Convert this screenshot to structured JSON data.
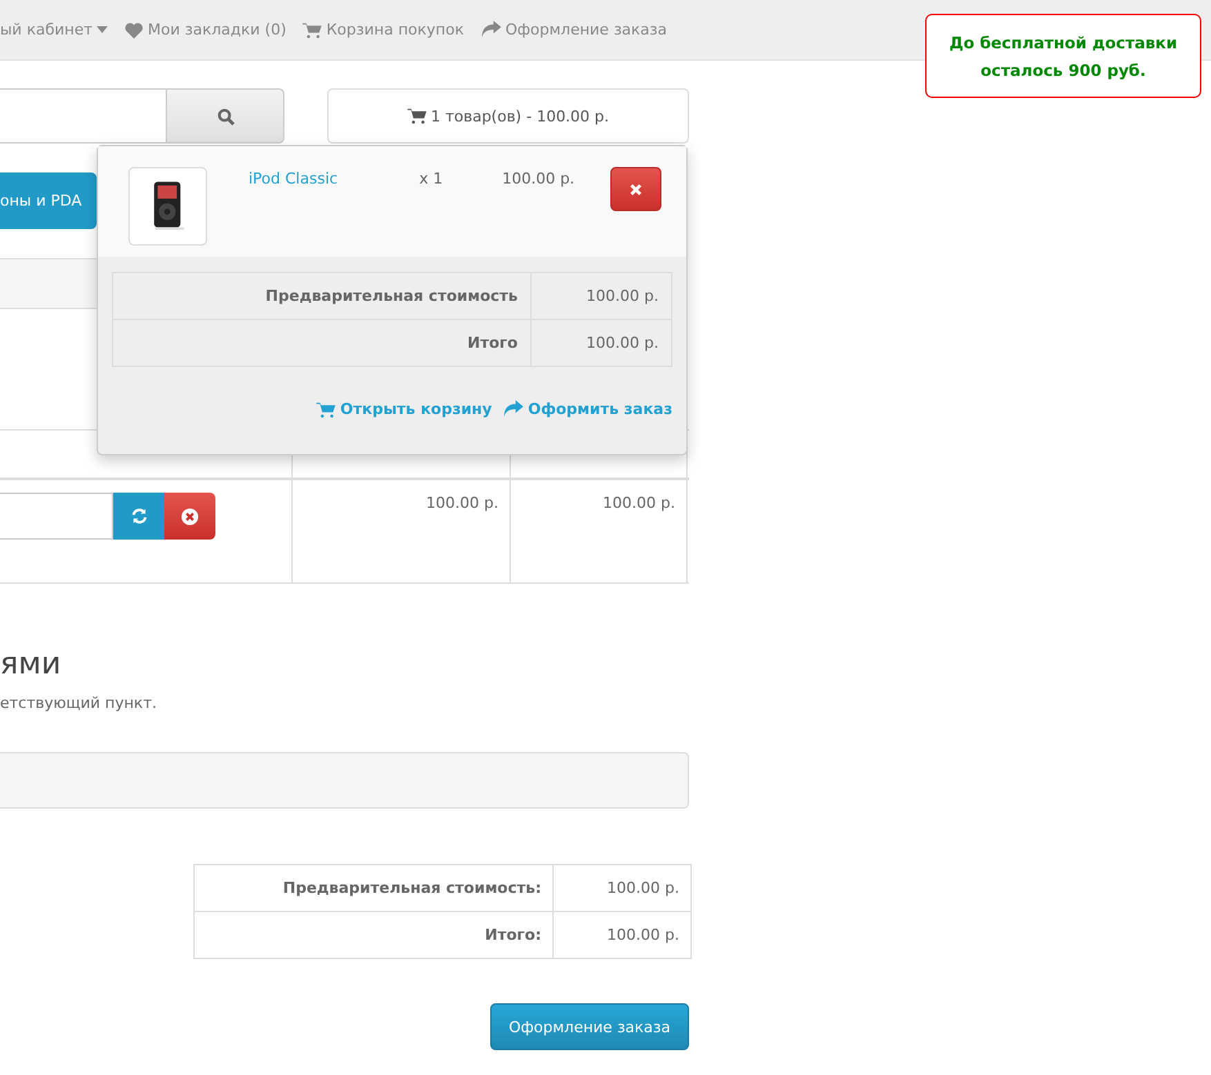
{
  "top_links": [
    {
      "kind": "account",
      "label": "ый кабинет"
    },
    {
      "kind": "wishlist",
      "label": "Мои закладки (0)"
    },
    {
      "kind": "cart",
      "label": "Корзина покупок"
    },
    {
      "kind": "checkout",
      "label": "Оформление заказа"
    }
  ],
  "notice": "До бесплатной доставки осталось 900 руб.",
  "cart_button": "1 товар(ов) - 100.00 р.",
  "menu_item": "оны и PDA",
  "cart_dropdown": {
    "items": [
      {
        "name": "iPod Classic",
        "quantity": "x 1",
        "price": "100.00 р."
      }
    ],
    "totals": [
      {
        "label": "Предварительная стоимость",
        "value": "100.00 р."
      },
      {
        "label": "Итого",
        "value": "100.00 р."
      }
    ],
    "links": [
      {
        "kind": "cart",
        "label": "Открыть корзину"
      },
      {
        "kind": "checkout",
        "label": "Оформить заказ"
      }
    ]
  },
  "cart_row": {
    "unit_price": "100.00 р.",
    "total": "100.00 р."
  },
  "section_heading": "ями",
  "section_text": "етствующий пункт.",
  "totals": [
    {
      "label": "Предварительная стоимость:",
      "value": "100.00 р."
    },
    {
      "label": "Итого:",
      "value": "100.00 р."
    }
  ],
  "checkout_button": "Оформление заказа"
}
